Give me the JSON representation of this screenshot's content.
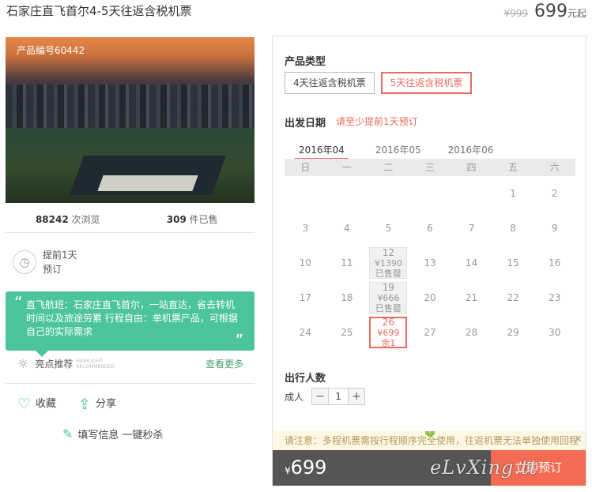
{
  "header": {
    "title": "石家庄直飞首尔4-5天往返含税机票",
    "original_price": "¥999",
    "price": "699",
    "price_unit": "元起"
  },
  "product": {
    "id_label": "产品编号60442",
    "views_count": "88242",
    "views_label": " 次浏览",
    "sold_count": "309",
    "sold_label": " 件已售",
    "advance_line1": "提前1天",
    "advance_line2": "预订"
  },
  "highlight": {
    "text": "直飞航班：石家庄直飞首尔，一站直达，省去转机时间以及旅途劳累 行程自由：单机票产品，可根据自己的实际需求",
    "label": "亮点推荐",
    "label_en": "HIGHLIGHT RECOMMENDED",
    "more": "查看更多"
  },
  "actions": {
    "favorite": "收藏",
    "share": "分享",
    "fill_info": "填写信息 一键秒杀"
  },
  "booking": {
    "type_title": "产品类型",
    "types": [
      "4天往返含税机票",
      "5天往返含税机票"
    ],
    "selected_type": 1,
    "date_title": "出发日期",
    "date_note": "请至少提前1天预订",
    "months": [
      "2016年04",
      "2016年05",
      "2016年06"
    ],
    "active_month": 0,
    "weekdays": [
      "日",
      "一",
      "二",
      "三",
      "四",
      "五",
      "六"
    ],
    "days": [
      {
        "d": ""
      },
      {
        "d": ""
      },
      {
        "d": ""
      },
      {
        "d": ""
      },
      {
        "d": ""
      },
      {
        "d": "1"
      },
      {
        "d": "2"
      },
      {
        "d": "3"
      },
      {
        "d": "4"
      },
      {
        "d": "5"
      },
      {
        "d": "6"
      },
      {
        "d": "7"
      },
      {
        "d": "8"
      },
      {
        "d": "9"
      },
      {
        "d": "10"
      },
      {
        "d": "11"
      },
      {
        "d": "12",
        "price": "¥1390",
        "status": "已售罄",
        "state": "soldout"
      },
      {
        "d": "13"
      },
      {
        "d": "14"
      },
      {
        "d": "15"
      },
      {
        "d": "16"
      },
      {
        "d": "17"
      },
      {
        "d": "18"
      },
      {
        "d": "19",
        "price": "¥666",
        "status": "已售罄",
        "state": "soldout"
      },
      {
        "d": "20"
      },
      {
        "d": "21"
      },
      {
        "d": "22"
      },
      {
        "d": "23"
      },
      {
        "d": "24"
      },
      {
        "d": "25"
      },
      {
        "d": "26",
        "price": "¥699",
        "status": "余1",
        "state": "avail"
      },
      {
        "d": "27"
      },
      {
        "d": "28"
      },
      {
        "d": "29"
      },
      {
        "d": "30"
      }
    ],
    "travelers_title": "出行人数",
    "adult_label": "成人",
    "adult_count": "1",
    "notice": "请注意：多程机票需按行程顺序完全使用，往返机票无法单独使用回程",
    "bottom_price": "699",
    "currency": "¥",
    "book_label": "立即预订"
  },
  "watermark": "eLvXing.tt",
  "colors": {
    "accent": "#e86d61",
    "green": "#4dc59a",
    "book": "#f36b52"
  }
}
